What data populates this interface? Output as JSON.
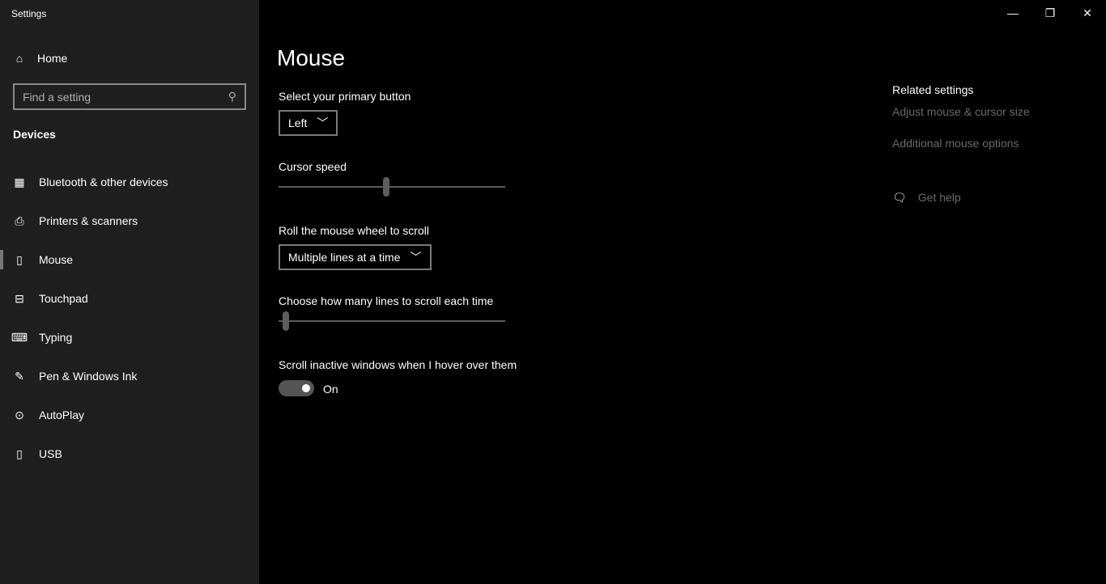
{
  "window": {
    "title": "Settings",
    "minimize": "—",
    "maximize": "❐",
    "close": "✕"
  },
  "sidebar": {
    "home": "Home",
    "search_placeholder": "Find a setting",
    "section": "Devices",
    "items": [
      {
        "label": "Bluetooth & other devices",
        "icon": "bluetooth-devices-icon",
        "glyph": "▦"
      },
      {
        "label": "Printers & scanners",
        "icon": "printer-icon",
        "glyph": "⎙"
      },
      {
        "label": "Mouse",
        "icon": "mouse-icon",
        "glyph": "▯",
        "selected": true
      },
      {
        "label": "Touchpad",
        "icon": "touchpad-icon",
        "glyph": "⊟"
      },
      {
        "label": "Typing",
        "icon": "keyboard-icon",
        "glyph": "⌨"
      },
      {
        "label": "Pen & Windows Ink",
        "icon": "pen-icon",
        "glyph": "✎"
      },
      {
        "label": "AutoPlay",
        "icon": "autoplay-icon",
        "glyph": "⊙"
      },
      {
        "label": "USB",
        "icon": "usb-icon",
        "glyph": "▯"
      }
    ]
  },
  "main": {
    "title": "Mouse",
    "primary_button": {
      "label": "Select your primary button",
      "value": "Left"
    },
    "cursor_speed": {
      "label": "Cursor speed",
      "value": 10,
      "min": 1,
      "max": 20
    },
    "wheel": {
      "label": "Roll the mouse wheel to scroll",
      "value": "Multiple lines at a time"
    },
    "lines": {
      "label": "Choose how many lines to scroll each time",
      "value": 3,
      "min": 1,
      "max": 100
    },
    "inactive": {
      "label": "Scroll inactive windows when I hover over them",
      "state": "On"
    }
  },
  "related": {
    "title": "Related settings",
    "links": [
      "Adjust mouse & cursor size",
      "Additional mouse options"
    ],
    "help": "Get help"
  }
}
